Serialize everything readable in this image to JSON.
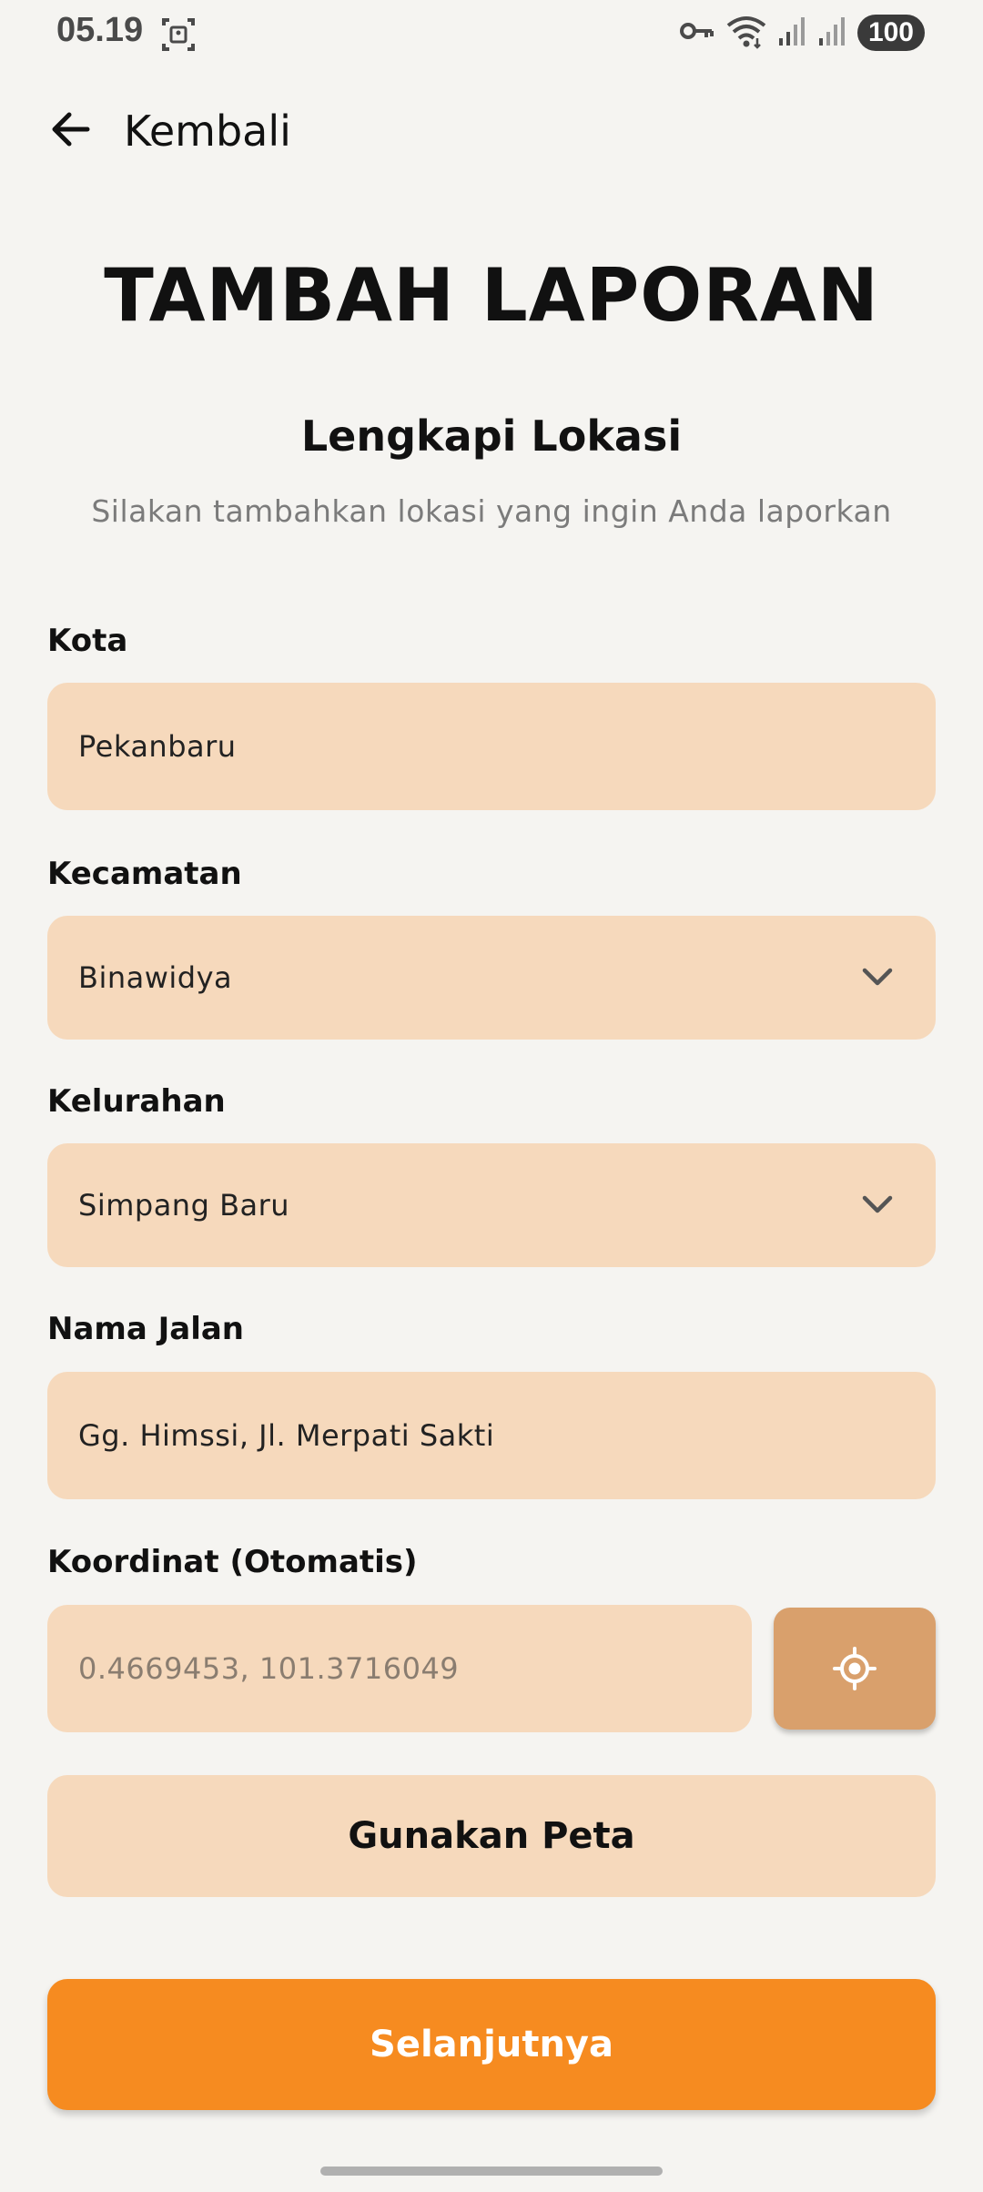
{
  "status_bar": {
    "time": "05.19",
    "battery": "100",
    "icons": [
      "screenshot-icon",
      "vpn-key-icon",
      "wifi-icon",
      "signal-icon",
      "signal-icon"
    ]
  },
  "nav": {
    "back_label": "Kembali",
    "back_icon": "arrow-left-icon"
  },
  "page": {
    "title": "TAMBAH LAPORAN",
    "section_title": "Lengkapi Lokasi",
    "section_subtitle": "Silakan tambahkan lokasi yang ingin Anda laporkan"
  },
  "form": {
    "kota": {
      "label": "Kota",
      "value": "Pekanbaru"
    },
    "kecamatan": {
      "label": "Kecamatan",
      "value": "Binawidya"
    },
    "kelurahan": {
      "label": "Kelurahan",
      "value": "Simpang Baru"
    },
    "nama_jalan": {
      "label": "Nama Jalan",
      "value": "Gg. Himssi, Jl. Merpati Sakti"
    },
    "koordinat": {
      "label": "Koordinat (Otomatis)",
      "value": "0.4669453, 101.3716049"
    }
  },
  "actions": {
    "use_map": "Gunakan Peta",
    "next": "Selanjutnya",
    "locate_icon": "gps-fixed-icon"
  },
  "colors": {
    "background": "#f5f4f1",
    "field_bg": "#f6d9bc",
    "locate_button": "#d9a06c",
    "primary": "#f68b20"
  }
}
